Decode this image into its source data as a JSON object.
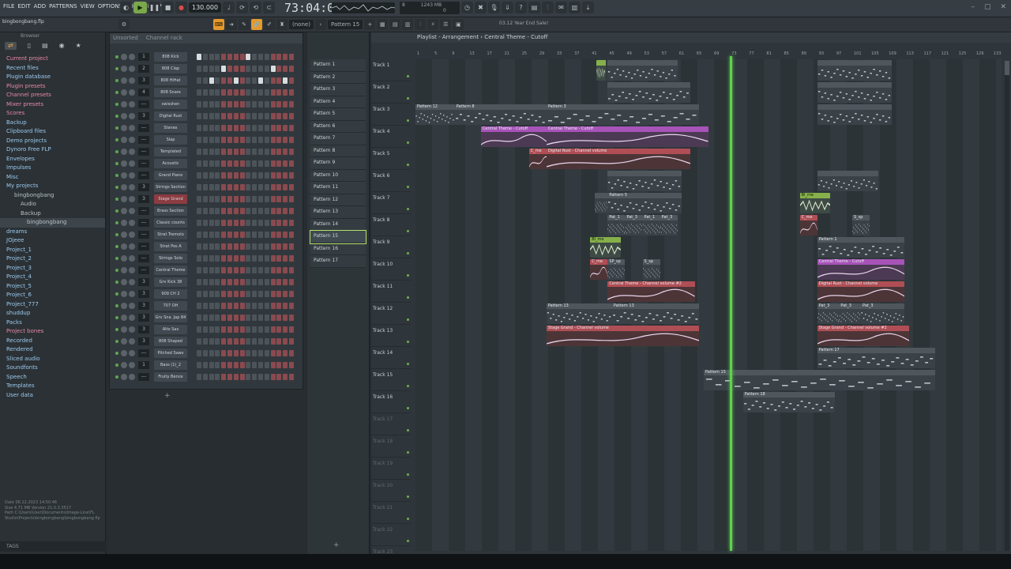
{
  "menu": [
    "FILE",
    "EDIT",
    "ADD",
    "PATTERNS",
    "VIEW",
    "OPTIONS",
    "TOOLS",
    "HELP"
  ],
  "transport": {
    "tempo": "130.000",
    "time": "73:04:00",
    "cpu_mem": "1243 MB",
    "cpu_val": "8",
    "cpu_poly": "0"
  },
  "toolbar2": {
    "project_file": "bingbongbang.flp",
    "snap": "(none)",
    "pattern_selected": "Pattern 15",
    "news": "03.12  Year End Sale!"
  },
  "browser": {
    "title": "Browser",
    "items": [
      {
        "label": "Current project",
        "style": "pink"
      },
      {
        "label": "Recent files",
        "style": "blue"
      },
      {
        "label": "Plugin database",
        "style": "blue"
      },
      {
        "label": "Plugin presets",
        "style": "pink"
      },
      {
        "label": "Channel presets",
        "style": "pink"
      },
      {
        "label": "Mixer presets",
        "style": "pink"
      },
      {
        "label": "Scores",
        "style": "pink"
      },
      {
        "label": "Backup",
        "style": "blue"
      },
      {
        "label": "Clipboard files",
        "style": "blue"
      },
      {
        "label": "Demo projects",
        "style": "blue"
      },
      {
        "label": "Dynoro Free FLP",
        "style": "blue"
      },
      {
        "label": "Envelopes",
        "style": "blue"
      },
      {
        "label": "Impulses",
        "style": "blue"
      },
      {
        "label": "Misc",
        "style": "blue"
      },
      {
        "label": "My projects",
        "style": "blue"
      },
      {
        "label": "bingbongbang",
        "style": "dim"
      },
      {
        "label": "Audio",
        "style": "dim"
      },
      {
        "label": "Backup",
        "style": "dim"
      },
      {
        "label": "bingbongbang",
        "style": "dim"
      },
      {
        "label": "dreams",
        "style": "blue"
      },
      {
        "label": "JOjeee",
        "style": "blue"
      },
      {
        "label": "Project_1",
        "style": "blue"
      },
      {
        "label": "Project_2",
        "style": "blue"
      },
      {
        "label": "Project_3",
        "style": "blue"
      },
      {
        "label": "Project_4",
        "style": "blue"
      },
      {
        "label": "Project_5",
        "style": "blue"
      },
      {
        "label": "Project_6",
        "style": "blue"
      },
      {
        "label": "Project_777",
        "style": "blue"
      },
      {
        "label": "shuddup",
        "style": "blue"
      },
      {
        "label": "Packs",
        "style": "blue"
      },
      {
        "label": "Project bones",
        "style": "pink"
      },
      {
        "label": "Recorded",
        "style": "blue"
      },
      {
        "label": "Rendered",
        "style": "blue"
      },
      {
        "label": "Sliced audio",
        "style": "blue"
      },
      {
        "label": "Soundfonts",
        "style": "blue"
      },
      {
        "label": "Speech",
        "style": "blue"
      },
      {
        "label": "Templates",
        "style": "blue"
      },
      {
        "label": "User data",
        "style": "blue"
      }
    ],
    "info": {
      "date": "Date    06.12.2023 14:50:46",
      "size": "Size    4.71 MB    Version 21.0.3.3517",
      "path": "Path    C:\\Users\\User\\Documents\\Image-Line\\FL Studio\\Projects\\bingbongbang\\bingbongbang.flp"
    },
    "tags_label": "TAGS"
  },
  "channel_rack": {
    "title": "Channel rack",
    "filter": "Unsorted",
    "channels": [
      {
        "num": "1",
        "name": "808 Kick",
        "steps": [
          1,
          0,
          0,
          0,
          0,
          0,
          0,
          0,
          1,
          0,
          0,
          0,
          0,
          0,
          0,
          0
        ]
      },
      {
        "num": "2",
        "name": "808 Clap",
        "steps": [
          0,
          0,
          0,
          0,
          1,
          0,
          0,
          0,
          0,
          0,
          0,
          0,
          1,
          0,
          0,
          0
        ]
      },
      {
        "num": "3",
        "name": "808 HiHat",
        "steps": [
          0,
          0,
          1,
          0,
          0,
          0,
          1,
          0,
          0,
          0,
          1,
          0,
          0,
          0,
          1,
          0
        ]
      },
      {
        "num": "4",
        "name": "808 Snare",
        "steps": [
          0,
          0,
          0,
          0,
          0,
          0,
          0,
          0,
          0,
          0,
          0,
          0,
          0,
          0,
          0,
          0
        ]
      },
      {
        "num": "---",
        "name": "swisshen",
        "steps": [
          0,
          0,
          0,
          0,
          0,
          0,
          0,
          0,
          0,
          0,
          0,
          0,
          0,
          0,
          0,
          0
        ]
      },
      {
        "num": "3",
        "name": "Digital Rust",
        "steps": [
          0,
          0,
          0,
          0,
          0,
          0,
          0,
          0,
          0,
          0,
          0,
          0,
          0,
          0,
          0,
          0
        ]
      },
      {
        "num": "---",
        "name": "Stanex",
        "steps": [
          0,
          0,
          0,
          0,
          0,
          0,
          0,
          0,
          0,
          0,
          0,
          0,
          0,
          0,
          0,
          0
        ]
      },
      {
        "num": "---",
        "name": "Slap",
        "steps": [
          0,
          0,
          0,
          0,
          0,
          0,
          0,
          0,
          0,
          0,
          0,
          0,
          0,
          0,
          0,
          0
        ]
      },
      {
        "num": "---",
        "name": "Templated",
        "steps": [
          0,
          0,
          0,
          0,
          0,
          0,
          0,
          0,
          0,
          0,
          0,
          0,
          0,
          0,
          0,
          0
        ]
      },
      {
        "num": "---",
        "name": "Acoustic",
        "steps": [
          0,
          0,
          0,
          0,
          0,
          0,
          0,
          0,
          0,
          0,
          0,
          0,
          0,
          0,
          0,
          0
        ]
      },
      {
        "num": "---",
        "name": "Grand Piano",
        "steps": [
          0,
          0,
          0,
          0,
          0,
          0,
          0,
          0,
          0,
          0,
          0,
          0,
          0,
          0,
          0,
          0
        ]
      },
      {
        "num": "3",
        "name": "Strings Section",
        "steps": [
          0,
          0,
          0,
          0,
          0,
          0,
          0,
          0,
          0,
          0,
          0,
          0,
          0,
          0,
          0,
          0
        ]
      },
      {
        "num": "3",
        "name": "Stage Grand",
        "steps": [
          0,
          0,
          0,
          0,
          0,
          0,
          0,
          0,
          0,
          0,
          0,
          0,
          0,
          0,
          0,
          0
        ],
        "red": true
      },
      {
        "num": "---",
        "name": "Brass Section",
        "steps": [
          0,
          0,
          0,
          0,
          0,
          0,
          0,
          0,
          0,
          0,
          0,
          0,
          0,
          0,
          0,
          0
        ]
      },
      {
        "num": "---",
        "name": "Classic counts",
        "steps": [
          0,
          0,
          0,
          0,
          0,
          0,
          0,
          0,
          0,
          0,
          0,
          0,
          0,
          0,
          0,
          0
        ]
      },
      {
        "num": "---",
        "name": "Strat Tremolo",
        "steps": [
          0,
          0,
          0,
          0,
          0,
          0,
          0,
          0,
          0,
          0,
          0,
          0,
          0,
          0,
          0,
          0
        ]
      },
      {
        "num": "---",
        "name": "Strat Pos A",
        "steps": [
          0,
          0,
          0,
          0,
          0,
          0,
          0,
          0,
          0,
          0,
          0,
          0,
          0,
          0,
          0,
          0
        ]
      },
      {
        "num": "---",
        "name": "Strings Solo",
        "steps": [
          0,
          0,
          0,
          0,
          0,
          0,
          0,
          0,
          0,
          0,
          0,
          0,
          0,
          0,
          0,
          0
        ]
      },
      {
        "num": "---",
        "name": "Central Theme",
        "steps": [
          0,
          0,
          0,
          0,
          0,
          0,
          0,
          0,
          0,
          0,
          0,
          0,
          0,
          0,
          0,
          0
        ]
      },
      {
        "num": "3",
        "name": "Grv Kick 38",
        "steps": [
          0,
          0,
          0,
          0,
          0,
          0,
          0,
          0,
          0,
          0,
          0,
          0,
          0,
          0,
          0,
          0
        ]
      },
      {
        "num": "3",
        "name": "909 CH 2",
        "steps": [
          0,
          0,
          0,
          0,
          0,
          0,
          0,
          0,
          0,
          0,
          0,
          0,
          0,
          0,
          0,
          0
        ]
      },
      {
        "num": "3",
        "name": "707 OH",
        "steps": [
          0,
          0,
          0,
          0,
          0,
          0,
          0,
          0,
          0,
          0,
          0,
          0,
          0,
          0,
          0,
          0
        ]
      },
      {
        "num": "3",
        "name": "Grv Sna. Jap 84",
        "steps": [
          0,
          0,
          0,
          0,
          0,
          0,
          0,
          0,
          0,
          0,
          0,
          0,
          0,
          0,
          0,
          0
        ]
      },
      {
        "num": "3",
        "name": "Alto Sax",
        "steps": [
          0,
          0,
          0,
          0,
          0,
          0,
          0,
          0,
          0,
          0,
          0,
          0,
          0,
          0,
          0,
          0
        ]
      },
      {
        "num": "3",
        "name": "808 Shaped",
        "steps": [
          0,
          0,
          0,
          0,
          0,
          0,
          0,
          0,
          0,
          0,
          0,
          0,
          0,
          0,
          0,
          0
        ]
      },
      {
        "num": "---",
        "name": "Pitched Saws",
        "steps": [
          0,
          0,
          0,
          0,
          0,
          0,
          0,
          0,
          0,
          0,
          0,
          0,
          0,
          0,
          0,
          0
        ]
      },
      {
        "num": "1",
        "name": "Bass (1)_2",
        "steps": [
          0,
          0,
          0,
          0,
          0,
          0,
          0,
          0,
          0,
          0,
          0,
          0,
          0,
          0,
          0,
          0
        ]
      },
      {
        "num": "---",
        "name": "Fruity Bence",
        "steps": [
          0,
          0,
          0,
          0,
          0,
          0,
          0,
          0,
          0,
          0,
          0,
          0,
          0,
          0,
          0,
          0
        ]
      }
    ],
    "add_label": "+"
  },
  "patterns": [
    "Pattern 1",
    "Pattern 2",
    "Pattern 3",
    "Pattern 4",
    "Pattern 5",
    "Pattern 6",
    "Pattern 7",
    "Pattern 8",
    "Pattern 9",
    "Pattern 10",
    "Pattern 11",
    "Pattern 12",
    "Pattern 13",
    "Pattern 14",
    "Pattern 15",
    "Pattern 16",
    "Pattern 17"
  ],
  "patterns_add": "+",
  "playlist": {
    "title": "Playlist - Arrangement › Central Theme - Cutoff",
    "ruler": [
      "1",
      "5",
      "9",
      "13",
      "17",
      "21",
      "25",
      "29",
      "33",
      "37",
      "41",
      "45",
      "49",
      "53",
      "57",
      "61",
      "65",
      "69",
      "73",
      "77",
      "81",
      "85",
      "89",
      "93",
      "97",
      "101",
      "105",
      "109",
      "113",
      "117",
      "121",
      "125",
      "129",
      "133"
    ],
    "tracks": [
      "Track 1",
      "Track 2",
      "Track 3",
      "Track 4",
      "Track 5",
      "Track 6",
      "Track 7",
      "Track 8",
      "Track 9",
      "Track 10",
      "Track 11",
      "Track 12",
      "Track 13",
      "Track 14",
      "Track 15",
      "Track 16",
      "Track 17",
      "Track 18",
      "Track 19",
      "Track 20",
      "Track 21",
      "Track 22",
      "Track 23"
    ],
    "clips": [
      {
        "track": 0,
        "start": 42.5,
        "len": 2,
        "type": "aud",
        "label": ""
      },
      {
        "track": 0,
        "start": 45,
        "len": 16,
        "type": "pat",
        "label": ""
      },
      {
        "track": 0,
        "start": 93,
        "len": 17,
        "type": "pat",
        "label": ""
      },
      {
        "track": 1,
        "start": 45,
        "len": 19,
        "type": "pat",
        "label": ""
      },
      {
        "track": 1,
        "start": 93,
        "len": 17,
        "type": "pat",
        "label": ""
      },
      {
        "track": 2,
        "start": 1,
        "len": 9,
        "type": "pat",
        "label": "Pattern 12"
      },
      {
        "track": 2,
        "start": 10,
        "len": 21,
        "type": "pat",
        "label": "Pattern 8"
      },
      {
        "track": 2,
        "start": 31,
        "len": 35,
        "type": "pat",
        "label": "Pattern 3"
      },
      {
        "track": 2,
        "start": 93,
        "len": 17,
        "type": "pat",
        "label": ""
      },
      {
        "track": 3,
        "start": 16,
        "len": 15,
        "type": "auto-p",
        "label": "Central Theme - Cutoff"
      },
      {
        "track": 3,
        "start": 31,
        "len": 37,
        "type": "auto-p",
        "label": "Central Theme - Cutoff"
      },
      {
        "track": 4,
        "start": 27,
        "len": 5,
        "type": "auto-r",
        "label": "C_me"
      },
      {
        "track": 4,
        "start": 31,
        "len": 33,
        "type": "auto-r",
        "label": "Digital Rust - Channel volume"
      },
      {
        "track": 5,
        "start": 45,
        "len": 17,
        "type": "pat",
        "label": ""
      },
      {
        "track": 5,
        "start": 93,
        "len": 14,
        "type": "pat",
        "label": ""
      },
      {
        "track": 6,
        "start": 42,
        "len": 3,
        "type": "pat",
        "label": ""
      },
      {
        "track": 6,
        "start": 45,
        "len": 17,
        "type": "pat",
        "label": "Pattern 5"
      },
      {
        "track": 6,
        "start": 89,
        "len": 7,
        "type": "aud",
        "label": "Bl_me"
      },
      {
        "track": 7,
        "start": 45,
        "len": 4,
        "type": "pat",
        "label": "Pat_1"
      },
      {
        "track": 7,
        "start": 49,
        "len": 4,
        "type": "pat",
        "label": "Pat_3"
      },
      {
        "track": 7,
        "start": 53,
        "len": 4,
        "type": "pat",
        "label": "Pat_1"
      },
      {
        "track": 7,
        "start": 57,
        "len": 4,
        "type": "pat",
        "label": "Pat_3"
      },
      {
        "track": 7,
        "start": 89,
        "len": 4,
        "type": "auto-r",
        "label": "C_me"
      },
      {
        "track": 7,
        "start": 101,
        "len": 4,
        "type": "pat",
        "label": "S_sp"
      },
      {
        "track": 8,
        "start": 41,
        "len": 7,
        "type": "aud",
        "label": "Bl_me"
      },
      {
        "track": 8,
        "start": 93,
        "len": 20,
        "type": "pat",
        "label": "Pattern 1"
      },
      {
        "track": 9,
        "start": 41,
        "len": 4,
        "type": "auto-r",
        "label": "C_me"
      },
      {
        "track": 9,
        "start": 45,
        "len": 4,
        "type": "pat",
        "label": "SP_sp"
      },
      {
        "track": 9,
        "start": 53,
        "len": 4,
        "type": "pat",
        "label": "S_sp"
      },
      {
        "track": 9,
        "start": 93,
        "len": 20,
        "type": "auto-p",
        "label": "Central Theme - Cutoff"
      },
      {
        "track": 10,
        "start": 45,
        "len": 20,
        "type": "auto-r",
        "label": "Central Theme - Channel volume #2"
      },
      {
        "track": 10,
        "start": 93,
        "len": 20,
        "type": "auto-r",
        "label": "Digital Rust - Channel volume"
      },
      {
        "track": 11,
        "start": 31,
        "len": 15,
        "type": "pat",
        "label": "Pattern 13"
      },
      {
        "track": 11,
        "start": 46,
        "len": 20,
        "type": "pat",
        "label": "Pattern 13"
      },
      {
        "track": 11,
        "start": 93,
        "len": 5,
        "type": "pat",
        "label": "Pat_3"
      },
      {
        "track": 11,
        "start": 98,
        "len": 5,
        "type": "pat",
        "label": "Pat_3"
      },
      {
        "track": 11,
        "start": 103,
        "len": 10,
        "type": "pat",
        "label": "Pat_3"
      },
      {
        "track": 12,
        "start": 31,
        "len": 35,
        "type": "auto-r",
        "label": "Stage Grand - Channel volume"
      },
      {
        "track": 12,
        "start": 93,
        "len": 21,
        "type": "auto-r",
        "label": "Stage Grand - Channel volume #2"
      },
      {
        "track": 13,
        "start": 93,
        "len": 27,
        "type": "pat",
        "label": "Pattern 17"
      },
      {
        "track": 14,
        "start": 67,
        "len": 53,
        "type": "pat",
        "label": "Pattern 15"
      },
      {
        "track": 15,
        "start": 76,
        "len": 21,
        "type": "pat",
        "label": "Pattern 18"
      }
    ],
    "playhead_bar": 73
  },
  "colors": {
    "accent_green": "#5fd24e",
    "accent_orange": "#e49a2c",
    "auto_purple": "#a753b8",
    "auto_red": "#b04e55"
  }
}
